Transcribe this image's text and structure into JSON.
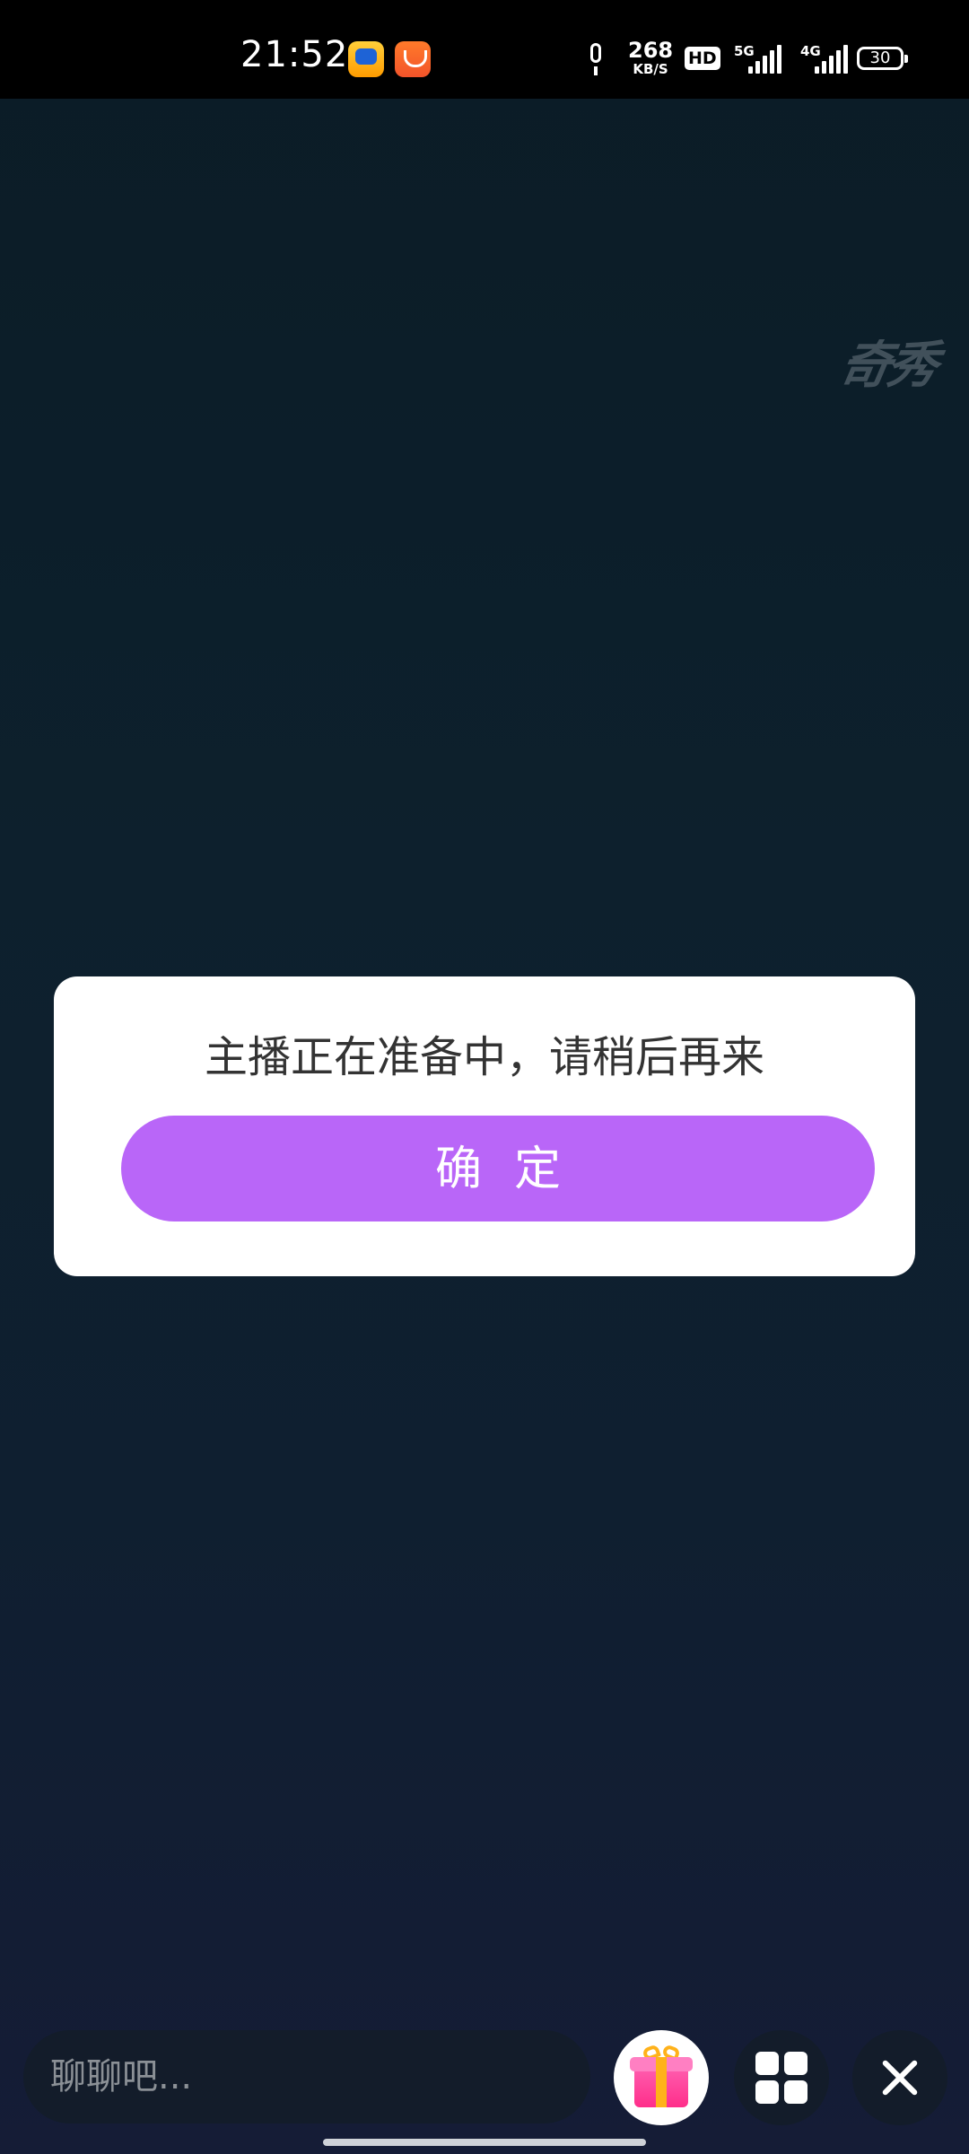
{
  "status_bar": {
    "time": "21:52",
    "net_speed_value": "268",
    "net_speed_unit": "KB/S",
    "hd_label": "HD",
    "signal_5g_label": "5G",
    "signal_4g_label": "4G",
    "battery_level": "30",
    "app_icons": [
      "video-app-icon",
      "uc-browser-icon"
    ]
  },
  "watermark": {
    "text": "奇秀"
  },
  "dialog": {
    "message": "主播正在准备中，请稍后再来",
    "confirm_label": "确定",
    "accent_color": "#b966f8"
  },
  "bottom_bar": {
    "chat_placeholder": "聊聊吧...",
    "icons": [
      "gift-icon",
      "grid-menu-icon",
      "close-icon"
    ]
  }
}
